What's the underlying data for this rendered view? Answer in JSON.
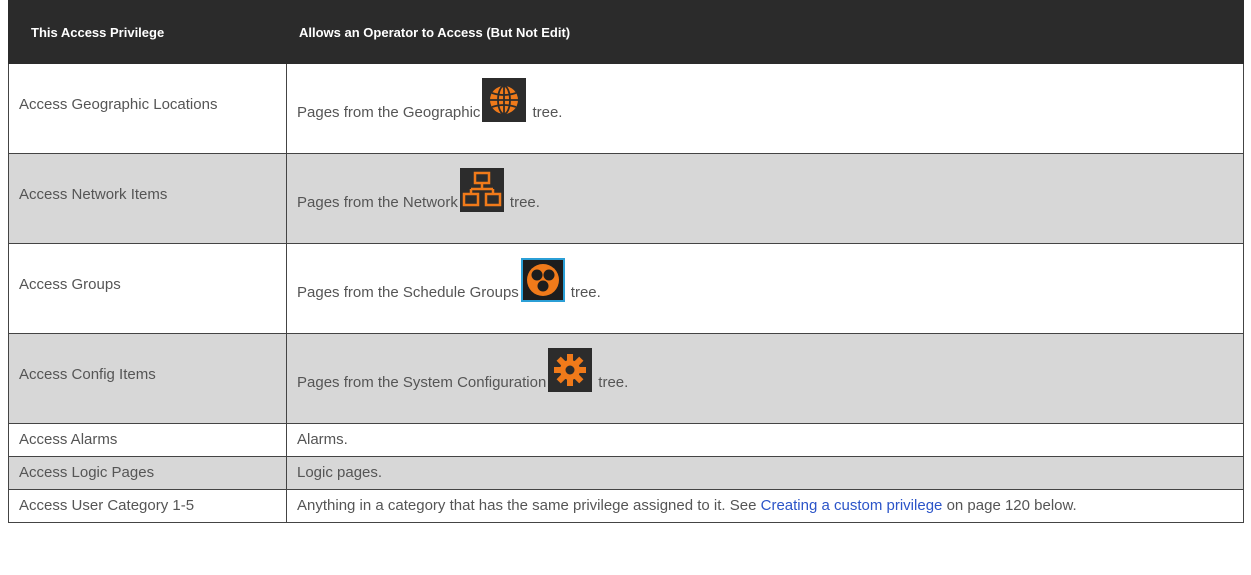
{
  "table": {
    "headers": [
      "This Access Privilege",
      "Allows an Operator to Access (But Not Edit)"
    ],
    "rows": [
      {
        "privilege": "Access Geographic Locations",
        "desc_before": "Pages from the Geographic",
        "icon": "globe-icon",
        "desc_after": "tree."
      },
      {
        "privilege": "Access Network Items",
        "desc_before": "Pages from the Network",
        "icon": "network-tree-icon",
        "desc_after": "tree."
      },
      {
        "privilege": "Access Groups",
        "desc_before": "Pages from the Schedule Groups",
        "icon": "schedule-groups-icon",
        "desc_after": "tree."
      },
      {
        "privilege": "Access Config Items",
        "desc_before": "Pages from the System Configuration",
        "icon": "gear-icon",
        "desc_after": "tree."
      },
      {
        "privilege": "Access Alarms",
        "desc": "Alarms."
      },
      {
        "privilege": "Access Logic Pages",
        "desc": "Logic pages."
      },
      {
        "privilege": "Access User Category 1-5",
        "desc_before": "Anything in a category that has the same privilege assigned to it. See",
        "link": "Creating a custom privilege",
        "desc_after": "on page 120 below."
      }
    ]
  },
  "colors": {
    "header_bg": "#2b2b2b",
    "row_alt_bg": "#d7d7d7",
    "icon_orange": "#f07a1a",
    "link": "#2b54c8"
  }
}
